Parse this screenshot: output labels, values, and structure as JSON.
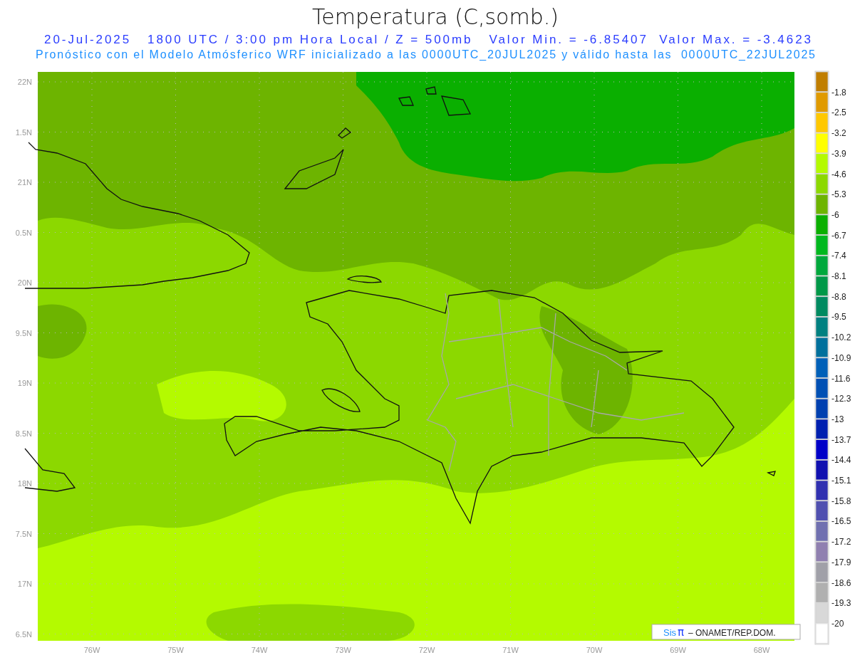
{
  "title": "Temperatura (C,somb.)",
  "subtitle_lines": [
    "20-Jul-2025   1800 UTC / 3:00 pm Hora Local / Z = 500mb   Valor Min. = -6.85407  Valor Max. = -3.4623",
    "Pronóstico con el Modelo Atmósferico WRF inicializado a las 0000UTC_20JUL2025 y válido hasta las  0000UTC_22JUL2025"
  ],
  "y_axis": [
    "22N",
    "1.5N",
    "21N",
    "0.5N",
    "20N",
    "9.5N",
    "19N",
    "8.5N",
    "18N",
    "7.5N",
    "17N",
    "6.5N"
  ],
  "x_axis": [
    "76W",
    "75W",
    "74W",
    "73W",
    "72W",
    "71W",
    "70W",
    "69W",
    "68W"
  ],
  "colorbar": {
    "boxes": [
      {
        "color": "#c07e00"
      },
      {
        "color": "#e09a00"
      },
      {
        "color": "#ffc800"
      },
      {
        "color": "#ffff00"
      },
      {
        "color": "#b4fa00"
      },
      {
        "color": "#8cd800"
      },
      {
        "color": "#6db400"
      },
      {
        "color": "#0aaf00"
      },
      {
        "color": "#00b81e"
      },
      {
        "color": "#00a83c"
      },
      {
        "color": "#009848"
      },
      {
        "color": "#008a60"
      },
      {
        "color": "#008080"
      },
      {
        "color": "#00709c"
      },
      {
        "color": "#0060b8"
      },
      {
        "color": "#0050b4"
      },
      {
        "color": "#0040b0"
      },
      {
        "color": "#0020b0"
      },
      {
        "color": "#0000c8"
      },
      {
        "color": "#1010b0"
      },
      {
        "color": "#3030b0"
      },
      {
        "color": "#5050b0"
      },
      {
        "color": "#7070b0"
      },
      {
        "color": "#9080b0"
      },
      {
        "color": "#a0a0a8"
      },
      {
        "color": "#b0b0b0"
      },
      {
        "color": "#d8d8d8"
      },
      {
        "color": "#ffffff"
      }
    ],
    "labels": [
      "-1.8",
      "-2.5",
      "-3.2",
      "-3.9",
      "-4.6",
      "-5.3",
      "-6",
      "-6.7",
      "-7.4",
      "-8.1",
      "-8.8",
      "-9.5",
      "-10.2",
      "-10.9",
      "-11.6",
      "-12.3",
      "-13",
      "-13.7",
      "-14.4",
      "-15.1",
      "-15.8",
      "-16.5",
      "-17.2",
      "-17.9",
      "-18.6",
      "-19.3",
      "-20"
    ]
  },
  "credit": {
    "brand_1": "Sis",
    "brand_2": "π",
    "text": "– ONAMET/REP.DOM."
  }
}
